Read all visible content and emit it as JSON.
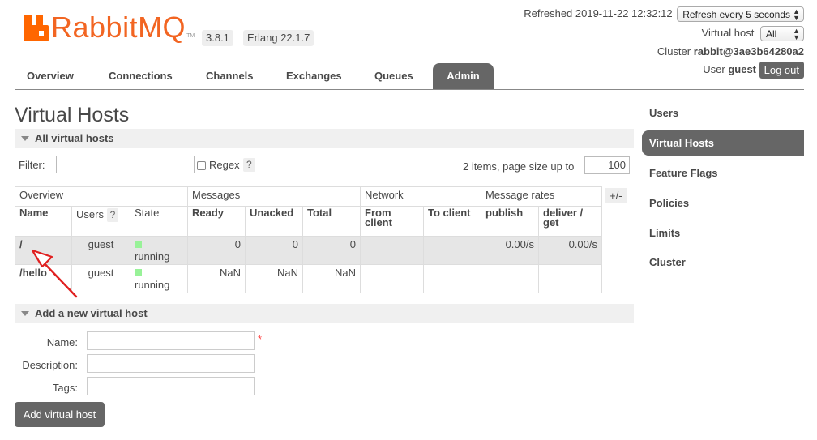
{
  "app": {
    "logo_text": "RabbitMQ",
    "logo_tm": "TM",
    "version": "3.8.1",
    "erlang": "Erlang 22.1.7"
  },
  "header": {
    "refreshed": "Refreshed 2019-11-22 12:32:12",
    "refresh_select": "Refresh every 5 seconds",
    "vhost_label": "Virtual host",
    "vhost_select": "All",
    "cluster_label": "Cluster",
    "cluster_name": "rabbit@3ae3b64280a2",
    "user_label": "User",
    "user_name": "guest",
    "logout": "Log out"
  },
  "tabs": [
    "Overview",
    "Connections",
    "Channels",
    "Exchanges",
    "Queues",
    "Admin"
  ],
  "active_tab": "Admin",
  "page_title": "Virtual Hosts",
  "all_vhosts": {
    "section_title": "All virtual hosts",
    "filter_label": "Filter:",
    "regex_label": "Regex",
    "help": "?",
    "items_text": "2 items, page size up to",
    "page_size": "100",
    "plus_minus": "+/-",
    "group_headers": [
      "Overview",
      "Messages",
      "Network",
      "Message rates"
    ],
    "column_headers": {
      "name": "Name",
      "users": "Users",
      "state": "State",
      "ready": "Ready",
      "unacked": "Unacked",
      "total": "Total",
      "from_client": "From client",
      "to_client": "To client",
      "publish": "publish",
      "deliver_get": "deliver / get"
    },
    "rows": [
      {
        "name": "/",
        "users": "guest",
        "state": "running",
        "ready": "0",
        "unacked": "0",
        "total": "0",
        "from_client": "",
        "to_client": "",
        "publish": "0.00/s",
        "deliver_get": "0.00/s"
      },
      {
        "name": "/hello",
        "users": "guest",
        "state": "running",
        "ready": "NaN",
        "unacked": "NaN",
        "total": "NaN",
        "from_client": "",
        "to_client": "",
        "publish": "",
        "deliver_get": ""
      }
    ]
  },
  "add_vhost": {
    "section_title": "Add a new virtual host",
    "name_label": "Name:",
    "description_label": "Description:",
    "tags_label": "Tags:",
    "required_mark": "*",
    "button": "Add virtual host"
  },
  "sidebar": {
    "items": [
      "Users",
      "Virtual Hosts",
      "Feature Flags",
      "Policies",
      "Limits",
      "Cluster"
    ],
    "active": "Virtual Hosts"
  },
  "colors": {
    "brand": "#ff6600",
    "tab_active": "#666666",
    "state_running": "#98f298",
    "annotation": "#e02020"
  }
}
